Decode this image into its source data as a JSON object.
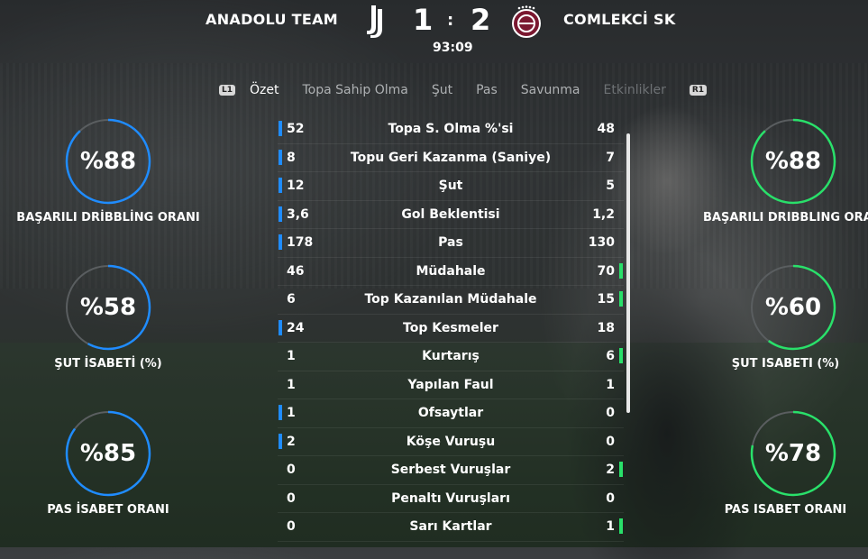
{
  "header": {
    "home_team": "ANADOLU TEAM",
    "away_team": "COMLEKCİ SK",
    "home_score": "1",
    "score_separator": ":",
    "away_score": "2",
    "match_clock": "93:09"
  },
  "tabs": {
    "left_button": "L1",
    "right_button": "R1",
    "items": [
      "Özet",
      "Topa Sahip Olma",
      "Şut",
      "Pas",
      "Savunma",
      "Etkinlikler"
    ],
    "active": "Özet"
  },
  "stats": [
    {
      "label": "Topa S. Olma %'si",
      "home": "52",
      "away": "48",
      "leader": "home"
    },
    {
      "label": "Topu Geri Kazanma (Saniye)",
      "home": "8",
      "away": "7",
      "leader": "home"
    },
    {
      "label": "Şut",
      "home": "12",
      "away": "5",
      "leader": "home"
    },
    {
      "label": "Gol Beklentisi",
      "home": "3,6",
      "away": "1,2",
      "leader": "home"
    },
    {
      "label": "Pas",
      "home": "178",
      "away": "130",
      "leader": "home"
    },
    {
      "label": "Müdahale",
      "home": "46",
      "away": "70",
      "leader": "away"
    },
    {
      "label": "Top Kazanılan Müdahale",
      "home": "6",
      "away": "15",
      "leader": "away"
    },
    {
      "label": "Top Kesmeler",
      "home": "24",
      "away": "18",
      "leader": "home"
    },
    {
      "label": "Kurtarış",
      "home": "1",
      "away": "6",
      "leader": "away"
    },
    {
      "label": "Yapılan Faul",
      "home": "1",
      "away": "1",
      "leader": "none"
    },
    {
      "label": "Ofsaytlar",
      "home": "1",
      "away": "0",
      "leader": "home"
    },
    {
      "label": "Köşe Vuruşu",
      "home": "2",
      "away": "0",
      "leader": "home"
    },
    {
      "label": "Serbest Vuruşlar",
      "home": "0",
      "away": "2",
      "leader": "away"
    },
    {
      "label": "Penaltı Vuruşları",
      "home": "0",
      "away": "0",
      "leader": "none"
    },
    {
      "label": "Sarı Kartlar",
      "home": "0",
      "away": "1",
      "leader": "away"
    }
  ],
  "home_gauges": [
    {
      "value": "%88",
      "percent": 88,
      "label": "BAŞARILI DRİBBLİNG ORANI"
    },
    {
      "value": "%58",
      "percent": 58,
      "label": "ŞUT İSABETİ (%)"
    },
    {
      "value": "%85",
      "percent": 85,
      "label": "PAS İSABET ORANI"
    }
  ],
  "away_gauges": [
    {
      "value": "%88",
      "percent": 88,
      "label": "BAŞARILI DRİBBLİNG ORANI"
    },
    {
      "value": "%60",
      "percent": 60,
      "label": "ŞUT İSABETİ (%)"
    },
    {
      "value": "%78",
      "percent": 78,
      "label": "PAS İSABET ORANI"
    }
  ],
  "colors": {
    "home_accent": "#1f8cff",
    "away_accent": "#29e06a",
    "gauge_track": "#5a5e60"
  }
}
